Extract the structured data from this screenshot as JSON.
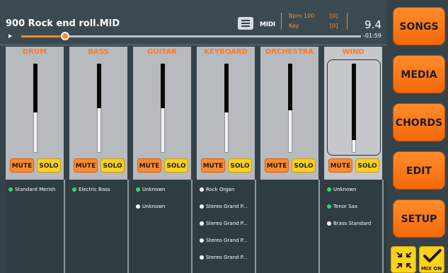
{
  "header": {
    "song_title": "900 Rock end roll.MID",
    "midi_label": "MIDI",
    "bpm_label": "Bpm 100",
    "bpm_extra": "[0]",
    "key_label": "Key",
    "key_extra": "[0]",
    "time": "9.4",
    "time_remaining": "-01:59",
    "progress_fraction": 0.13
  },
  "channels": [
    {
      "name": "DRUM",
      "mute": "MUTE",
      "solo": "SOLO",
      "level": 0.55
    },
    {
      "name": "BASS",
      "mute": "MUTE",
      "solo": "SOLO",
      "level": 0.5
    },
    {
      "name": "GUITAR",
      "mute": "MUTE",
      "solo": "SOLO",
      "level": 0.5
    },
    {
      "name": "KEYBOARD",
      "mute": "MUTE",
      "solo": "SOLO",
      "level": 0.55
    },
    {
      "name": "ORCHESTRA",
      "mute": "MUTE",
      "solo": "SOLO",
      "level": 0.52
    },
    {
      "name": "WIND",
      "mute": "MUTE",
      "solo": "SOLO",
      "level": 0.86,
      "selected": true
    }
  ],
  "instruments": [
    [
      {
        "label": "Standard Merish",
        "dot": "green"
      }
    ],
    [
      {
        "label": "Electric Bass",
        "dot": "green"
      }
    ],
    [
      {
        "label": "Unknown",
        "dot": "green"
      },
      {
        "label": "Unknown",
        "dot": "white"
      }
    ],
    [
      {
        "label": "Rock Organ",
        "dot": "white"
      },
      {
        "label": "Stereo Grand P...",
        "dot": "white"
      },
      {
        "label": "Stereo Grand P...",
        "dot": "white"
      },
      {
        "label": "Stereo Grand P...",
        "dot": "white"
      },
      {
        "label": "Stereo Grand P...",
        "dot": "white"
      }
    ],
    [],
    [
      {
        "label": "Unknown",
        "dot": "green"
      },
      {
        "label": "Tenor Sax",
        "dot": "green"
      },
      {
        "label": "Brass Standard",
        "dot": "white"
      }
    ]
  ],
  "sidebar": [
    "SONGS",
    "MEDIA",
    "CHORDS",
    "EDIT",
    "SETUP"
  ],
  "tools": {
    "mix_label": "MIX ON"
  },
  "colors": {
    "accent": "#ff8a2a",
    "solo": "#ffd11a",
    "bg": "#34434a"
  }
}
